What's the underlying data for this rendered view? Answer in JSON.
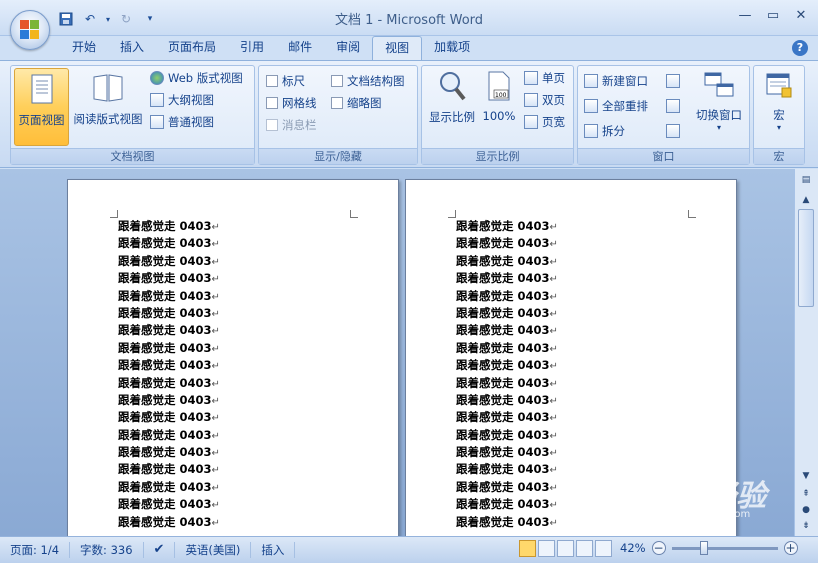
{
  "window": {
    "title": "文档 1 - Microsoft Word"
  },
  "tabs": [
    {
      "label": "开始"
    },
    {
      "label": "插入"
    },
    {
      "label": "页面布局"
    },
    {
      "label": "引用"
    },
    {
      "label": "邮件"
    },
    {
      "label": "审阅"
    },
    {
      "label": "视图",
      "active": true
    },
    {
      "label": "加载项"
    }
  ],
  "ribbon": {
    "doc_views": {
      "label": "文档视图",
      "page_view": "页面视图",
      "reading_view": "阅读版式视图",
      "web_view": "Web 版式视图",
      "outline_view": "大纲视图",
      "draft_view": "普通视图"
    },
    "show_hide": {
      "label": "显示/隐藏",
      "ruler": "标尺",
      "gridlines": "网格线",
      "message_bar": "消息栏",
      "doc_map": "文档结构图",
      "thumbnails": "缩略图"
    },
    "zoom": {
      "label": "显示比例",
      "zoom": "显示比例",
      "hundred": "100%",
      "one_page": "单页",
      "two_pages": "双页",
      "page_width": "页宽"
    },
    "window": {
      "label": "窗口",
      "new_window": "新建窗口",
      "arrange_all": "全部重排",
      "split": "拆分",
      "switch_windows": "切换窗口"
    },
    "macros": {
      "label": "宏",
      "macros": "宏"
    }
  },
  "document": {
    "line_text": "跟着感觉走 0403"
  },
  "status": {
    "page": "页面: 1/4",
    "words": "字数: 336",
    "language": "英语(美国)",
    "mode": "插入",
    "zoom": "42%"
  },
  "watermark": {
    "text": "Baidu经验",
    "sub": "jingyan.baidu.com"
  },
  "colors": {
    "accent": "#15428b",
    "active_button": "#ffcf5a"
  }
}
